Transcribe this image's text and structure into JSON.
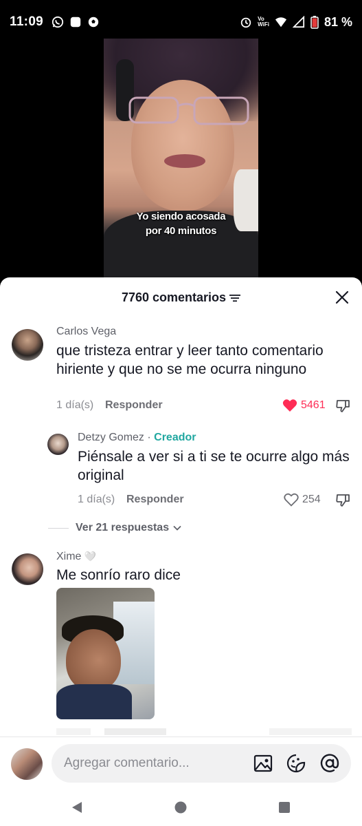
{
  "status_bar": {
    "time": "11:09",
    "battery": "81 %",
    "wifi_label_top": "Vo",
    "wifi_label_bottom": "WiFi"
  },
  "video": {
    "caption_line1": "Yo siendo acosada",
    "caption_line2": "por 40 minutos"
  },
  "panel": {
    "title": "7760 comentarios"
  },
  "comments": [
    {
      "name": "Carlos Vega",
      "text": "que tristeza entrar y leer tanto comentario hiriente y que no se me ocurra ninguno",
      "time": "1 día(s)",
      "reply": "Responder",
      "likes": "5461",
      "liked": true
    },
    {
      "name": "Detzy Gomez",
      "badge": "Creador",
      "separator": " · ",
      "text": "Piénsale a ver si a ti se te ocurre algo más original",
      "time": "1 día(s)",
      "reply": "Responder",
      "likes": "254",
      "liked": false
    },
    {
      "name": "Xime",
      "name_emoji": "🤍",
      "text": "Me sonrío raro dice"
    }
  ],
  "view_replies": "Ver 21 respuestas",
  "input": {
    "placeholder": "Agregar comentario..."
  },
  "colors": {
    "like_red": "#fe2c55",
    "creator_teal": "#20a7a0",
    "text_primary": "#161823",
    "text_secondary": "#8a8b91"
  }
}
